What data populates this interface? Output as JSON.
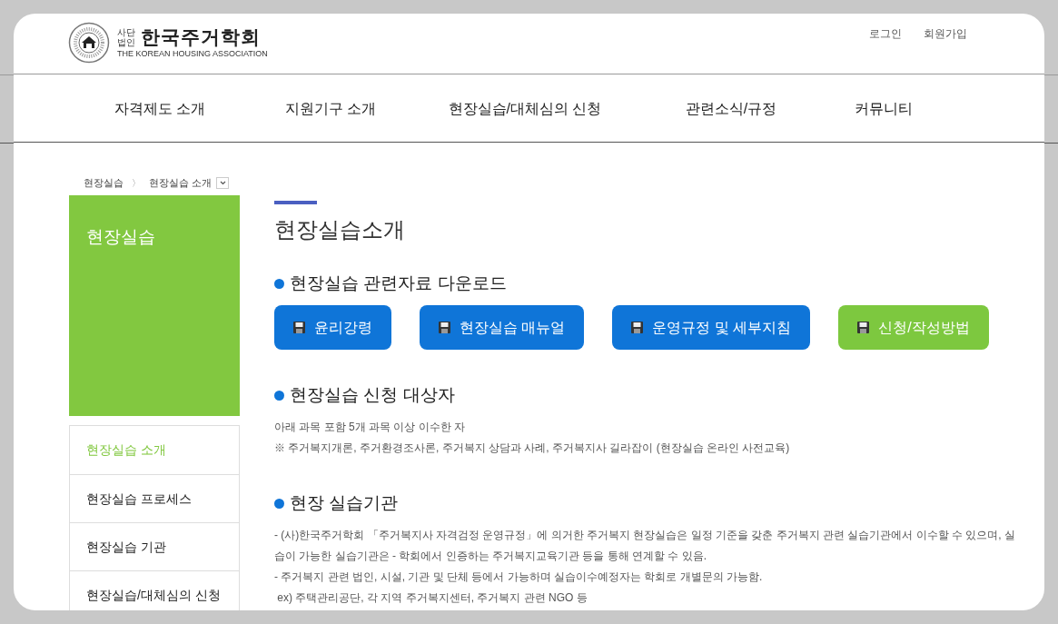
{
  "header": {
    "logo": {
      "corp_top": "사단",
      "corp_bottom": "법인",
      "name": "한국주거학회",
      "english": "THE KOREAN HOUSING ASSOCIATION"
    },
    "top_links": [
      "로그인",
      "회원가입"
    ]
  },
  "nav": [
    "자격제도 소개",
    "지원기구 소개",
    "현장실습/대체심의 신청",
    "관련소식/규정",
    "커뮤니티"
  ],
  "breadcrumb": {
    "items": [
      "현장실습",
      "현장실습 소개"
    ],
    "separator": "〉"
  },
  "sidebar": {
    "title": "현장실습",
    "items": [
      {
        "label": "현장실습 소개",
        "selected": true
      },
      {
        "label": "현장실습 프로세스",
        "selected": false
      },
      {
        "label": "현장실습 기관",
        "selected": false
      },
      {
        "label": "현장실습/대체심의 신청",
        "selected": false
      }
    ]
  },
  "page_title": "현장실습소개",
  "sections": [
    {
      "kind": "buttons",
      "heading": "현장실습 관련자료 다운로드",
      "buttons": [
        {
          "label": "윤리강령",
          "color": "#0f75d8"
        },
        {
          "label": "현장실습 매뉴얼",
          "color": "#0f75d8"
        },
        {
          "label": "운영규정 및 세부지침",
          "color": "#0f75d8"
        },
        {
          "label": "신청/작성방법",
          "color": "#7dc83f"
        }
      ]
    },
    {
      "kind": "text",
      "heading": "현장실습 신청 대상자",
      "lines": [
        "아래 과목 포함 5개 과목 이상 이수한 자",
        "※ 주거복지개론, 주거환경조사론, 주거복지 상담과 사례, 주거복지사 길라잡이 (현장실습 온라인 사전교육)"
      ]
    },
    {
      "kind": "text",
      "heading": "현장 실습기관",
      "lines": [
        "- (사)한국주거학회 「주거복지사 자격검정 운영규정」에 의거한 주거복지 현장실습은 일정 기준을 갖춘 주거복지 관련 실습기관에서 이수할 수 있으며, 실습이 가능한 실습기관은 - 학회에서 인증하는 주거복지교육기관 등을 통해 연계할 수 있음.",
        "- 주거복지 관련 법인, 시설, 기관 및 단체 등에서 가능하며 실습이수예정자는 학회로 개별문의 가능함.",
        " ex) 주택관리공단, 각 지역 주거복지센터, 주거복지 관련 NGO 등"
      ]
    }
  ]
}
